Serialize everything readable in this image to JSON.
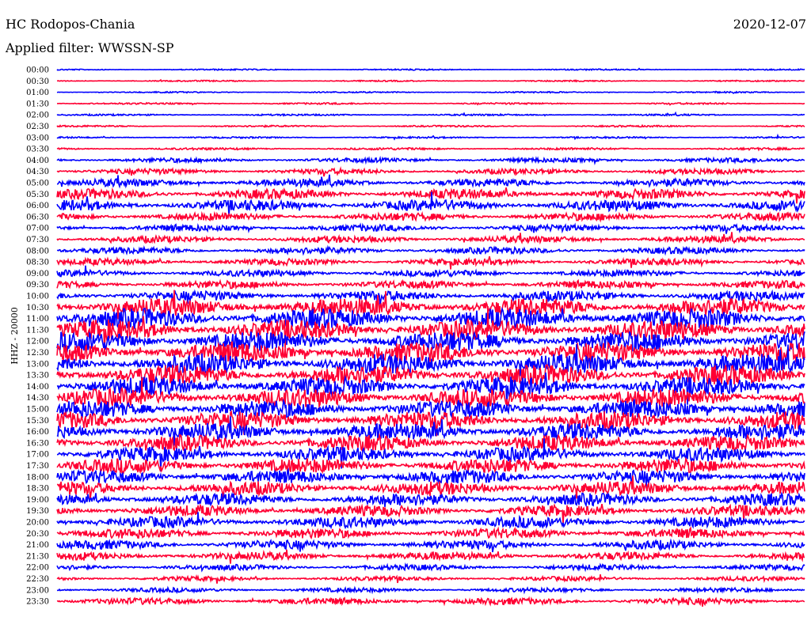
{
  "header": {
    "station": "HC Rodopos-Chania",
    "filter": "Applied filter: WWSSN-SP",
    "date": "2020-12-07"
  },
  "chart_data": {
    "type": "line",
    "title": "HC Rodopos-Chania",
    "ylabel": "HHZ - 20000",
    "xlabel": "",
    "row_labels": [
      "00:00",
      "00:30",
      "01:00",
      "01:30",
      "02:00",
      "02:30",
      "03:00",
      "03:30",
      "04:00",
      "04:30",
      "05:00",
      "05:30",
      "06:00",
      "06:30",
      "07:00",
      "07:30",
      "08:00",
      "08:30",
      "09:00",
      "09:30",
      "10:00",
      "10:30",
      "11:00",
      "11:30",
      "12:00",
      "12:30",
      "13:00",
      "13:30",
      "14:00",
      "14:30",
      "15:00",
      "15:30",
      "16:00",
      "16:30",
      "17:00",
      "17:30",
      "18:00",
      "18:30",
      "19:00",
      "19:30",
      "20:00",
      "20:30",
      "21:00",
      "21:30",
      "22:00",
      "22:30",
      "23:00",
      "23:30"
    ],
    "row_colors": [
      "#0000ff",
      "#ff0033"
    ],
    "relative_amplitude": [
      0.12,
      0.12,
      0.12,
      0.15,
      0.15,
      0.15,
      0.15,
      0.2,
      0.4,
      0.5,
      0.7,
      0.9,
      1.0,
      0.7,
      0.6,
      0.6,
      0.6,
      0.6,
      0.6,
      0.7,
      0.9,
      1.6,
      1.8,
      1.8,
      1.8,
      1.8,
      1.8,
      1.8,
      1.7,
      1.7,
      1.6,
      1.6,
      1.5,
      1.4,
      1.3,
      1.3,
      1.2,
      1.2,
      1.1,
      1.0,
      1.0,
      0.9,
      0.8,
      0.7,
      0.5,
      0.4,
      0.4,
      0.6
    ],
    "grid": false
  }
}
